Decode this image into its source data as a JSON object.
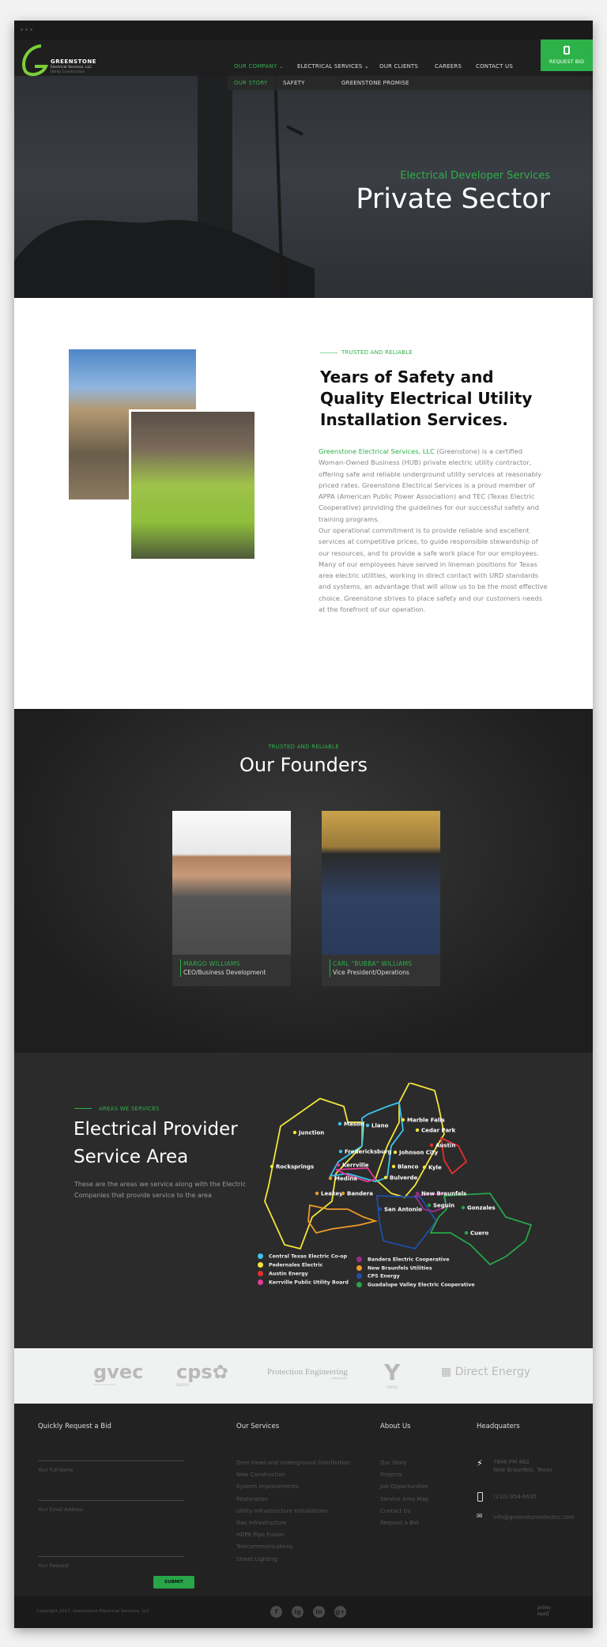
{
  "colors": {
    "accent": "#2fb04a",
    "dark": "#222222",
    "white": "#ffffff"
  },
  "brand": {
    "name": "GREENSTONE",
    "line2": "Electrical Services, LLC",
    "line3": "Utility Construction"
  },
  "nav": {
    "items": [
      {
        "label": "OUR COMPANY",
        "active": true
      },
      {
        "label": "ELECTRICAL SERVICES"
      },
      {
        "label": "OUR CLIENTS"
      },
      {
        "label": "CAREERS"
      },
      {
        "label": "CONTACT US"
      }
    ],
    "request_bid": "REQUEST BID",
    "sub": [
      {
        "label": "OUR STORY",
        "active": true
      },
      {
        "label": "SAFETY"
      },
      {
        "label": "GREENSTONE PROMISE"
      }
    ]
  },
  "hero": {
    "subtitle": "Electrical Developer Services",
    "title": "Private Sector"
  },
  "about": {
    "tag": "TRUSTED AND RELIABLE",
    "heading": "Years of Safety and Quality Electrical Utility Installation Services.",
    "company": "Greenstone Electrical Services, LLC",
    "p1": " (Greenstone) is a certified Woman-Owned Business (HUB) private electric utility contractor, offering safe and reliable underground utility services at reasonably priced rates. Greenstone Electrical Services is a proud member of APPA (American Public Power Association) and TEC (Texas Electric Cooperative) providing the guidelines for our successful safety and training programs.",
    "p2": "Our operational commitment is to provide reliable and excellent services at competitive prices, to guide responsible stewardship of our resources, and to provide a safe work place for our employees. Many of our employees have served in lineman positions for Texas area electric utilities, working in direct contact with URD standards and systems, an advantage that will allow us to be the most effective choice. Greenstone strives to place safety and our customers needs at the forefront of our operation."
  },
  "founders": {
    "tag": "TRUSTED AND RELIABLE",
    "title": "Our Founders",
    "people": [
      {
        "name": "MARGO WILLIAMS",
        "role": "CEO/Business Development"
      },
      {
        "name": "CARL \"BUBBA\" WILLIAMS",
        "role": "Vice President/Operations"
      }
    ]
  },
  "service": {
    "tag": "AREAS WE SERVICES",
    "title_line1": "Electrical Provider",
    "title_line2": "Service Area",
    "desc": "These are the areas we service along with the Electric Companies that provide service to the area",
    "cities": [
      "Junction",
      "Mason",
      "Llano",
      "Marble Falls",
      "Cedar Park",
      "Austin",
      "Fredericksburg",
      "Johnson City",
      "Rocksprings",
      "Kerrville",
      "Blanco",
      "Kyle",
      "Medina",
      "Bulverde",
      "Leakey",
      "Bandera",
      "New Braunfels",
      "San Antonio",
      "Seguin",
      "Gonzales",
      "Cuero"
    ],
    "legend": [
      {
        "label": "Central Texas Electric Co-op",
        "color": "#3bc4ef"
      },
      {
        "label": "Pedernales Electric",
        "color": "#f2e53a"
      },
      {
        "label": "Austin Energy",
        "color": "#e5302f"
      },
      {
        "label": "Kerrville Public Utility Board",
        "color": "#e33b96"
      },
      {
        "label": "Bandera Electric Cooperative",
        "color": "#9a2f8a"
      },
      {
        "label": "New Braunfels Utilities",
        "color": "#ef9a2a"
      },
      {
        "label": "CPS Energy",
        "color": "#1f4fa8"
      },
      {
        "label": "Guadalupe Valley Electric Cooperative",
        "color": "#27a548"
      }
    ]
  },
  "clients": [
    {
      "name": "gvec",
      "sub": "Your kind of power"
    },
    {
      "name": "cps",
      "sub": "ENERGY"
    },
    {
      "name": "Protection Engineering",
      "sub": "CONSULTANTS"
    },
    {
      "name": "Y",
      "sub": "YANTIS"
    },
    {
      "name": "Direct Energy",
      "sub": ""
    }
  ],
  "footer": {
    "bid": {
      "title": "Quickly Request a Bid",
      "fields": [
        "Your Full Name",
        "Your Email Address",
        "Your Request"
      ],
      "submit": "SUBMIT"
    },
    "services": {
      "title": "Our Services",
      "items": [
        "Over Head and Underground Distribution",
        "New Construction",
        "System Improvements",
        "Restoration",
        "Utility Infrastructure Installations",
        "Gas Infrastructure",
        "HDPE Pipe Fusion",
        "Telecommunications",
        "Street Lighting"
      ]
    },
    "about": {
      "title": "About Us",
      "items": [
        "Our Story",
        "Projects",
        "Job Opportunities",
        "Service Area Map",
        "Contact Us",
        "Request a Bid"
      ]
    },
    "hq": {
      "title": "Headquaters",
      "address1": "7846 FM 482",
      "address2": "New Braunfels, Texas",
      "phone": "(210) 954-6635",
      "email": "info@greenstoneelectric.com"
    },
    "copyright": "Copyright 2017, Greenstone Electrical Services, LLC",
    "social": [
      "f",
      "ig",
      "in",
      "g+"
    ],
    "credit": "primo motif"
  }
}
